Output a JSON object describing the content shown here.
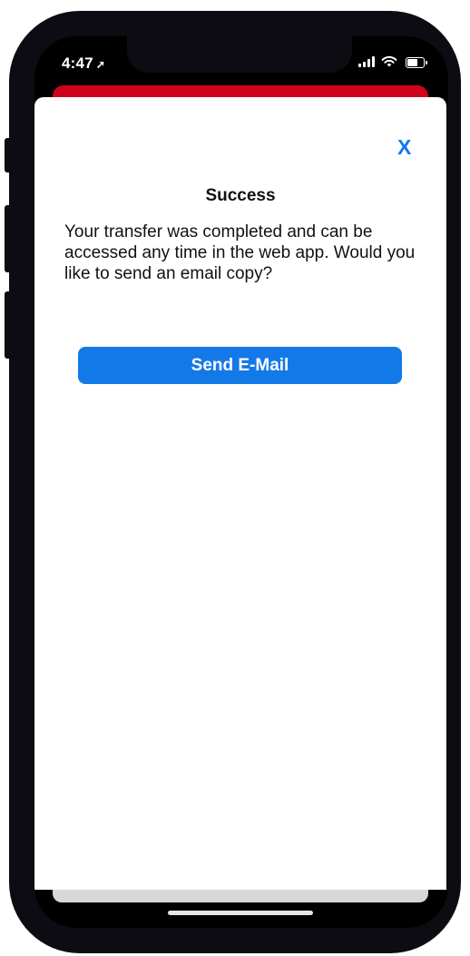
{
  "status_bar": {
    "time": "4:47",
    "location_icon": "location-arrow-icon",
    "icons": [
      "signal-bars-icon",
      "wifi-icon",
      "battery-icon"
    ]
  },
  "colors": {
    "accent": "#1479e8",
    "header_red": "#d0021b"
  },
  "modal": {
    "close_label": "X",
    "title": "Success",
    "message": "Your transfer was completed and can be accessed any time in the web app. Would you like to send an email copy?",
    "primary_button": "Send E-Mail"
  }
}
